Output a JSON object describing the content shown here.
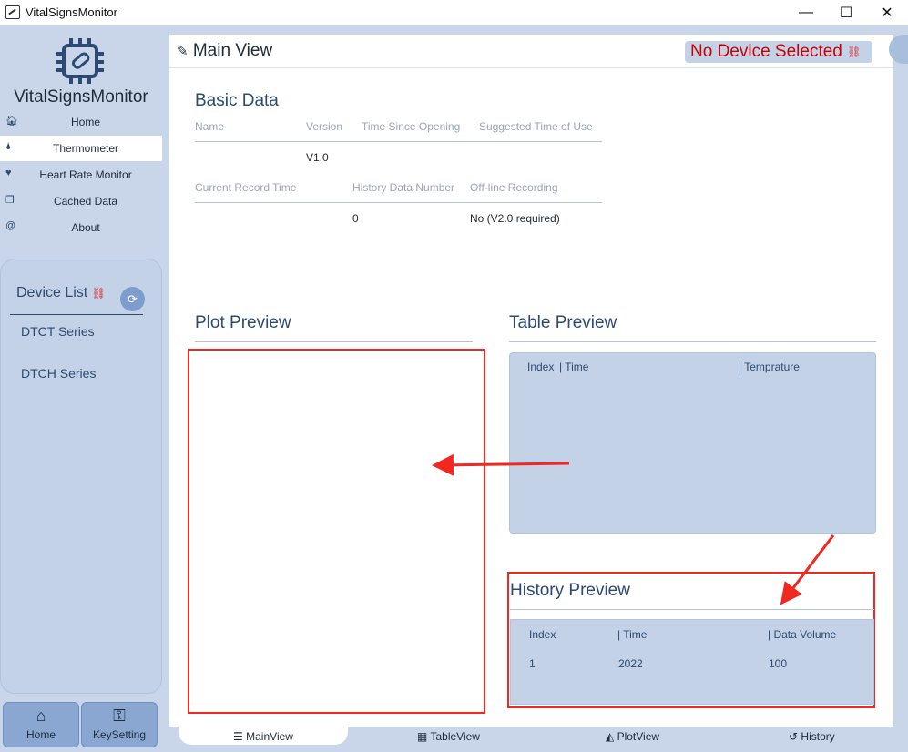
{
  "window": {
    "title": "VitalSignsMonitor",
    "minimize_label": "—",
    "maximize_label": "☐",
    "close_label": "✕"
  },
  "sidebar": {
    "brand": "VitalSignsMonitor",
    "items": [
      {
        "label": "Home",
        "icon": "home-icon",
        "glyph": "🏠︎"
      },
      {
        "label": "Thermometer",
        "icon": "thermometer-icon",
        "glyph": "🌢"
      },
      {
        "label": "Heart Rate Monitor",
        "icon": "heart-pulse-icon",
        "glyph": "♥"
      },
      {
        "label": "Cached  Data",
        "icon": "copy-icon",
        "glyph": "❐"
      },
      {
        "label": "About",
        "icon": "at-icon",
        "glyph": "@"
      }
    ],
    "active_index": 1,
    "device_list": {
      "title": "Device List",
      "series": [
        "DTCT Series",
        "DTCH Series"
      ]
    },
    "bottom_buttons": [
      {
        "label": "Home",
        "icon": "home-icon",
        "glyph": "⌂"
      },
      {
        "label": "KeySetting",
        "icon": "key-icon",
        "glyph": "⚿"
      }
    ]
  },
  "main": {
    "header": "Main View",
    "status": "No Device Selected",
    "basic_data": {
      "title": "Basic Data",
      "row1_labels": [
        "Name",
        "Version",
        "Time Since Opening",
        "Suggested Time of Use"
      ],
      "row1_values": [
        "",
        "V1.0",
        "",
        ""
      ],
      "row2_labels": [
        "Current Record Time",
        "History Data Number",
        "Off-line Recording"
      ],
      "row2_values": [
        "",
        "0",
        "No (V2.0 required)"
      ]
    },
    "plot_preview": {
      "title": "Plot Preview"
    },
    "table_preview": {
      "title": "Table Preview",
      "headers": [
        "Index",
        "| Time",
        "| Temprature"
      ]
    },
    "history_preview": {
      "title": "History Preview",
      "headers": [
        "Index",
        "| Time",
        "| Data Volume"
      ],
      "rows": [
        [
          "1",
          "2022",
          "100"
        ]
      ]
    }
  },
  "tabs": [
    {
      "label": "MainView",
      "icon": "list-icon",
      "glyph": "☰"
    },
    {
      "label": "TableView",
      "icon": "table-icon",
      "glyph": "▦"
    },
    {
      "label": "PlotView",
      "icon": "area-chart-icon",
      "glyph": "◭"
    },
    {
      "label": "History",
      "icon": "history-icon",
      "glyph": "↺"
    }
  ],
  "colors": {
    "sidebar_bg": "#c9d6ea",
    "accent": "#2c4a72",
    "status_red": "#cc0000",
    "annotation_red": "#f2271f"
  }
}
